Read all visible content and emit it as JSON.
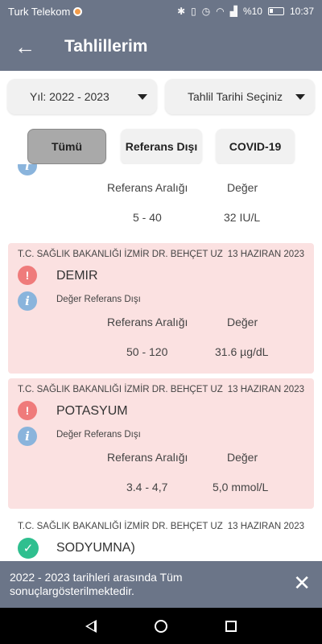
{
  "status": {
    "carrier": "Turk Telekom",
    "battery": "%10",
    "time": "10:37"
  },
  "appbar": {
    "title": "Tahlillerim"
  },
  "filters": {
    "year": "Yıl: 2022 - 2023",
    "date": "Tahlil Tarihi Seçiniz"
  },
  "chips": [
    {
      "label": "Tümü",
      "active": true
    },
    {
      "label": "Referans Dışı",
      "active": false
    },
    {
      "label": "COVID-19",
      "active": false
    }
  ],
  "partial": {
    "ref_header": "Referans Aralığı",
    "val_header": "Değer",
    "ref": "5 - 40",
    "val": "32 IU/L"
  },
  "results": [
    {
      "hospital": "T.C. SAĞLIK BAKANLIĞI İZMİR DR. BEHÇET UZ",
      "date": "13 HAZIRAN 2023",
      "name": "DEMIR",
      "note": "Değer Referans Dışı",
      "ref_header": "Referans Aralığı",
      "val_header": "Değer",
      "ref": "50 - 120",
      "val": "31.6 µg/dL",
      "status": "out"
    },
    {
      "hospital": "T.C. SAĞLIK BAKANLIĞI İZMİR DR. BEHÇET UZ",
      "date": "13 HAZIRAN 2023",
      "name": "POTASYUM",
      "note": "Değer Referans Dışı",
      "ref_header": "Referans Aralığı",
      "val_header": "Değer",
      "ref": "3.4 - 4,7",
      "val": "5,0 mmol/L",
      "status": "out"
    },
    {
      "hospital": "T.C. SAĞLIK BAKANLIĞI İZMİR DR. BEHÇET UZ",
      "date": "13 HAZIRAN 2023",
      "name": "SODYUMNA)",
      "status": "ok"
    }
  ],
  "snackbar": {
    "message": "2022 - 2023 tarihleri arasında Tüm sonuçlargösterilmektedir."
  },
  "icons": {
    "warning": "warning-icon",
    "info": "info-icon",
    "ok": "check-icon",
    "back": "arrow-left-icon"
  }
}
